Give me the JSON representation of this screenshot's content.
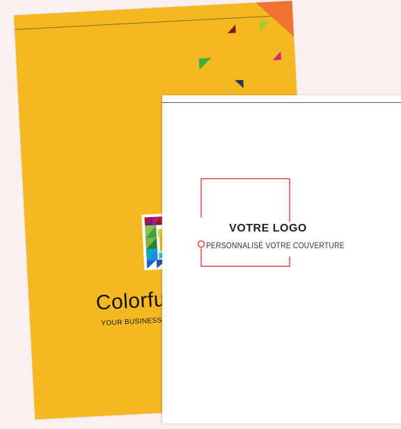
{
  "back_cover": {
    "brand_name": "Colorful",
    "tagline": "YOUR BUSINESS TAGLINE",
    "color": "#f4b820",
    "corner_color": "#ef7230"
  },
  "front_cover": {
    "logo_title": "VOTRE LOGO",
    "logo_subtitle": "PERSONNALISÉ VOTRE COUVERTURE",
    "frame_color": "#e0404a"
  },
  "icons": [
    "colorful-c-logo-icon",
    "confetti-triangle-icon"
  ]
}
